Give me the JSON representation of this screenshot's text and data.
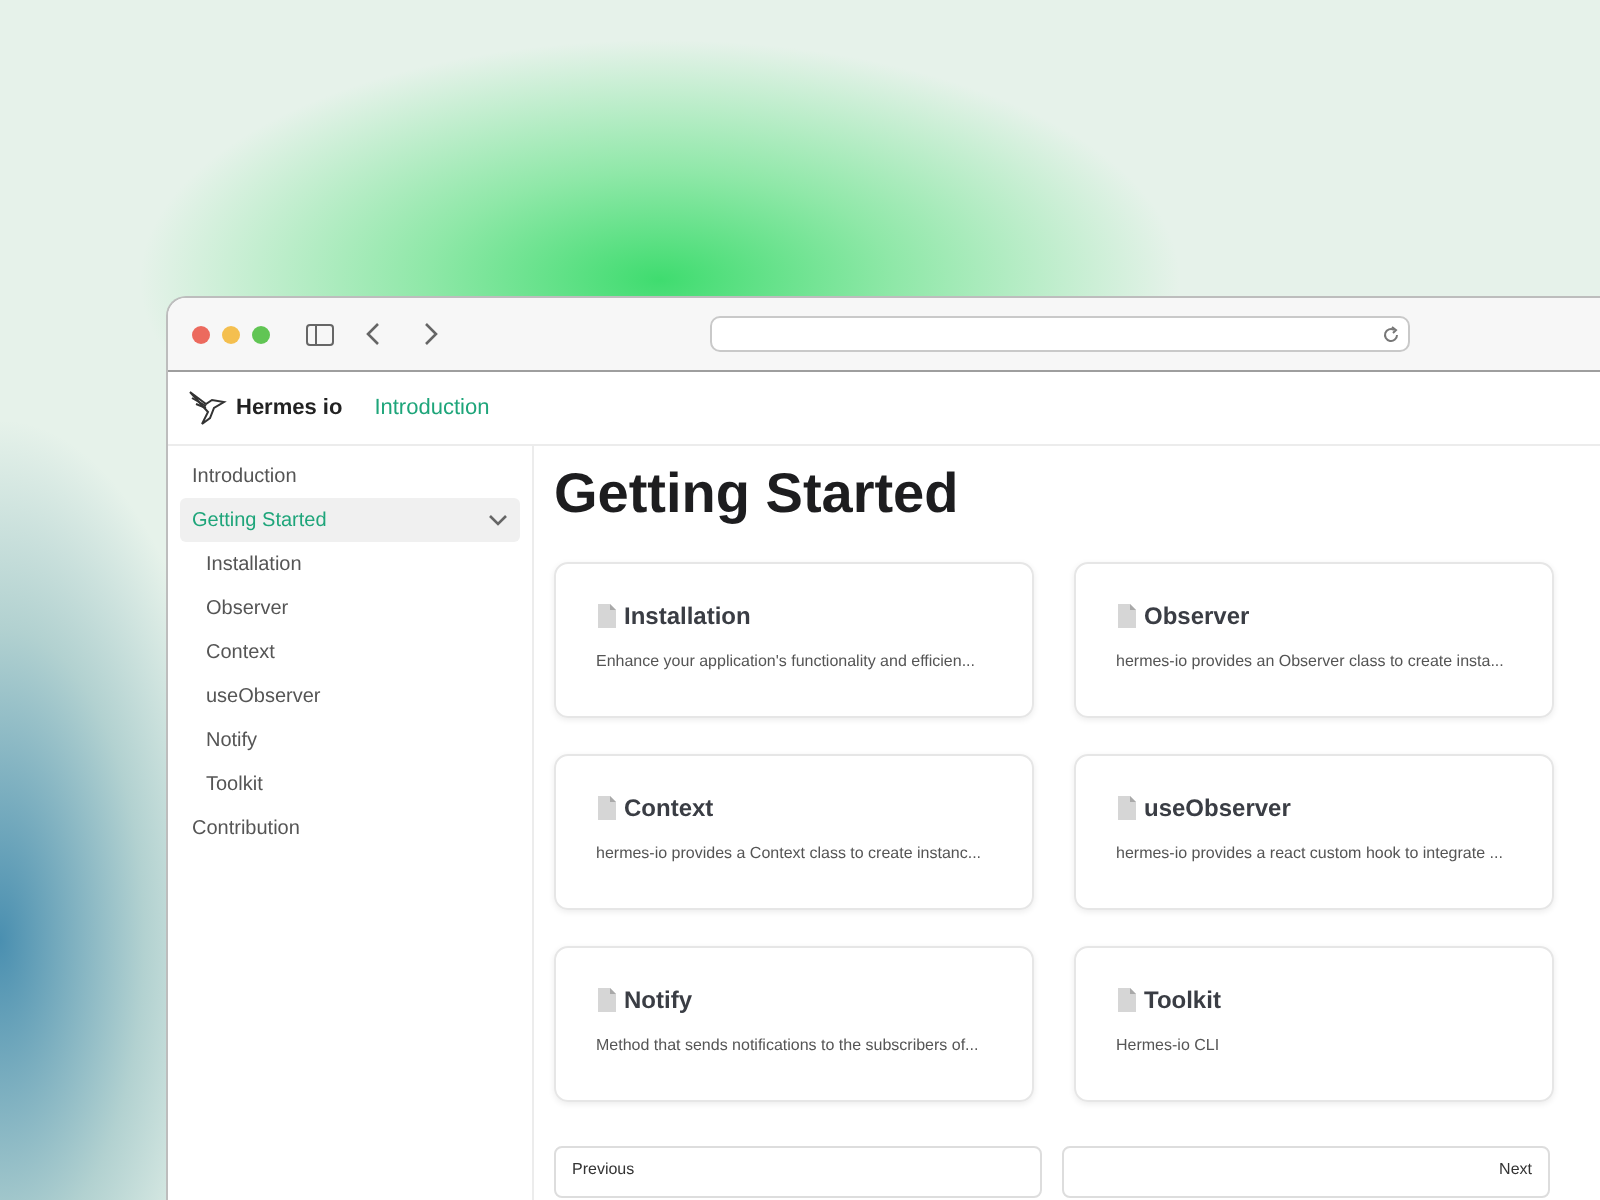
{
  "site": {
    "name": "Hermes io",
    "nav_link": "Introduction"
  },
  "sidebar": {
    "items": [
      {
        "label": "Introduction",
        "selected": false
      },
      {
        "label": "Getting Started",
        "selected": true,
        "expanded": true,
        "children": [
          {
            "label": "Installation",
            "selected": false
          },
          {
            "label": "Observer",
            "selected": false
          },
          {
            "label": "Context",
            "selected": false
          },
          {
            "label": "useObserver",
            "selected": false
          },
          {
            "label": "Notify",
            "selected": false
          },
          {
            "label": "Toolkit",
            "selected": false
          }
        ]
      },
      {
        "label": "Contribution",
        "selected": false
      }
    ]
  },
  "page": {
    "title": "Getting Started",
    "cards": [
      {
        "title": "Installation",
        "description": "Enhance your application's functionality and efficien..."
      },
      {
        "title": "Observer",
        "description": "hermes-io provides an Observer class to create insta..."
      },
      {
        "title": "Context",
        "description": "hermes-io provides a Context class to create instanc..."
      },
      {
        "title": "useObserver",
        "description": "hermes-io provides a react custom hook to integrate ..."
      },
      {
        "title": "Notify",
        "description": "Method that sends notifications to the subscribers of..."
      },
      {
        "title": "Toolkit",
        "description": "Hermes-io CLI"
      }
    ],
    "pager": {
      "previous": "Previous",
      "next": "Next"
    }
  }
}
